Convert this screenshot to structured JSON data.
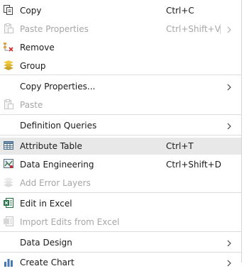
{
  "menu": {
    "items": [
      {
        "label": "Copy",
        "shortcut": "Ctrl+C",
        "icon": "copy-icon"
      },
      {
        "label": "Paste Properties",
        "shortcut": "Ctrl+Shift+V",
        "icon": "paste-properties-icon",
        "disabled": true
      },
      {
        "label": "Remove",
        "icon": "remove-icon"
      },
      {
        "label": "Group",
        "icon": "group-icon"
      },
      {
        "label": "Copy Properties...",
        "submenu": true
      },
      {
        "label": "Paste",
        "icon": "paste-icon",
        "disabled": true
      },
      {
        "label": "Definition Queries",
        "submenu": true
      },
      {
        "label": "Attribute Table",
        "shortcut": "Ctrl+T",
        "icon": "table-icon",
        "highlighted": true
      },
      {
        "label": "Data Engineering",
        "shortcut": "Ctrl+Shift+D",
        "icon": "data-engineering-icon"
      },
      {
        "label": "Add Error Layers",
        "icon": "error-layers-icon",
        "disabled": true
      },
      {
        "label": "Edit in Excel",
        "icon": "excel-icon"
      },
      {
        "label": "Import Edits from Excel",
        "icon": "import-excel-icon",
        "disabled": true
      },
      {
        "label": "Data Design",
        "submenu": true
      },
      {
        "label": "Create Chart",
        "icon": "chart-icon",
        "submenu": true
      }
    ]
  },
  "colors": {
    "highlight": "#e8e8e8",
    "disabled_text": "#a6a6a6",
    "separator": "#dcdcdc"
  }
}
